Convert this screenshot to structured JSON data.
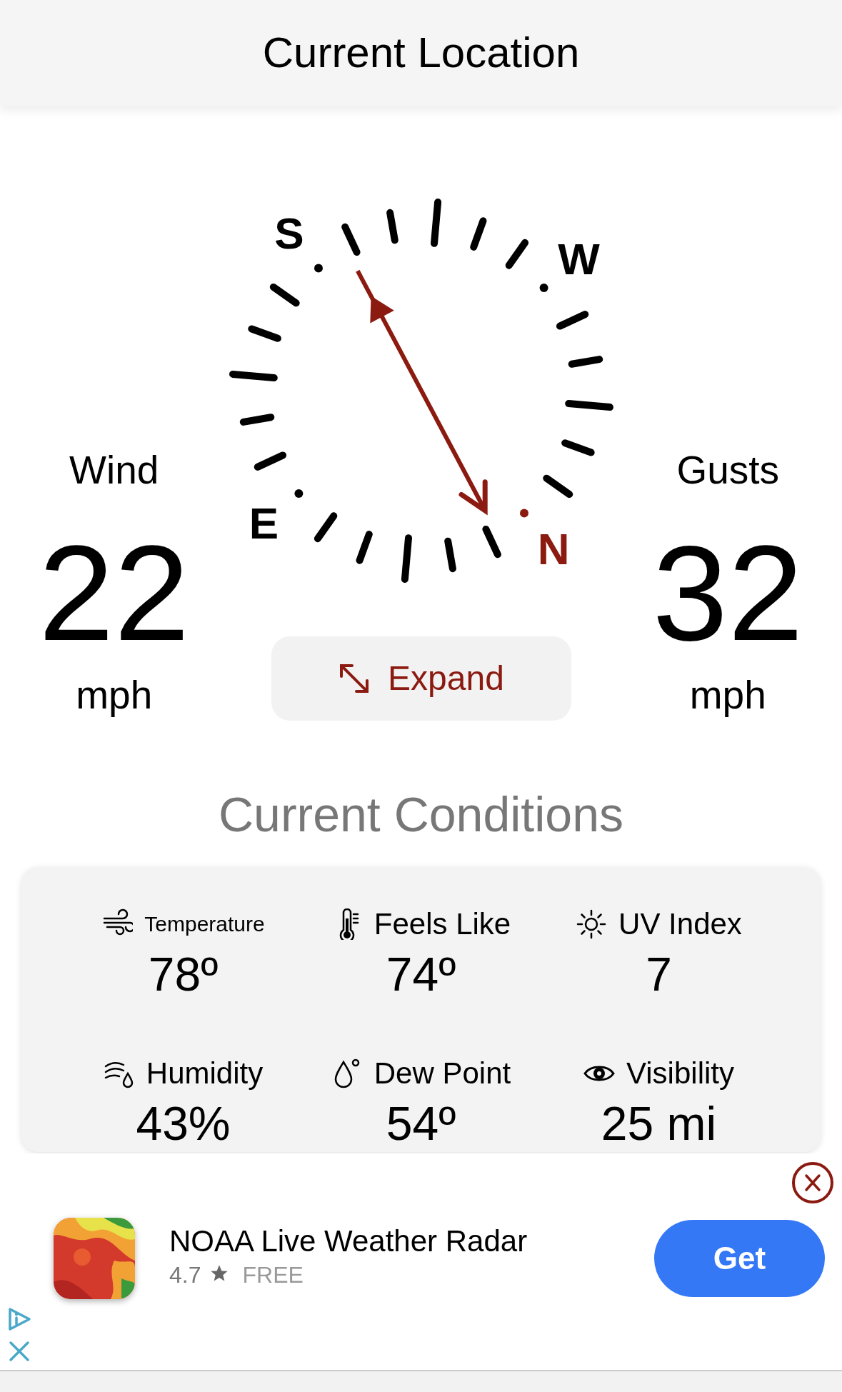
{
  "header": {
    "title": "Current Location"
  },
  "wind": {
    "label": "Wind",
    "value": "22",
    "unit": "mph"
  },
  "gusts": {
    "label": "Gusts",
    "value": "32",
    "unit": "mph"
  },
  "compass": {
    "labels": [
      {
        "text": "S",
        "color": "#000000"
      },
      {
        "text": "W",
        "color": "#000000"
      },
      {
        "text": "E",
        "color": "#000000"
      },
      {
        "text": "N",
        "color": "#8b1a10"
      }
    ]
  },
  "expand_button": {
    "label": "Expand"
  },
  "conditions": {
    "title": "Current Conditions",
    "items": [
      {
        "kind": "wind",
        "label": "Temperature",
        "value": "78º"
      },
      {
        "kind": "thermometer",
        "label": "Feels Like",
        "value": "74º"
      },
      {
        "kind": "sun",
        "label": "UV Index",
        "value": "7"
      },
      {
        "kind": "humidity",
        "label": "Humidity",
        "value": "43%"
      },
      {
        "kind": "drop",
        "label": "Dew Point",
        "value": "54º"
      },
      {
        "kind": "eye",
        "label": "Visibility",
        "value": "25 mi"
      }
    ]
  },
  "ad": {
    "app_name": "NOAA Live Weather Radar",
    "rating": "4.7",
    "price": "FREE",
    "button": "Get"
  }
}
